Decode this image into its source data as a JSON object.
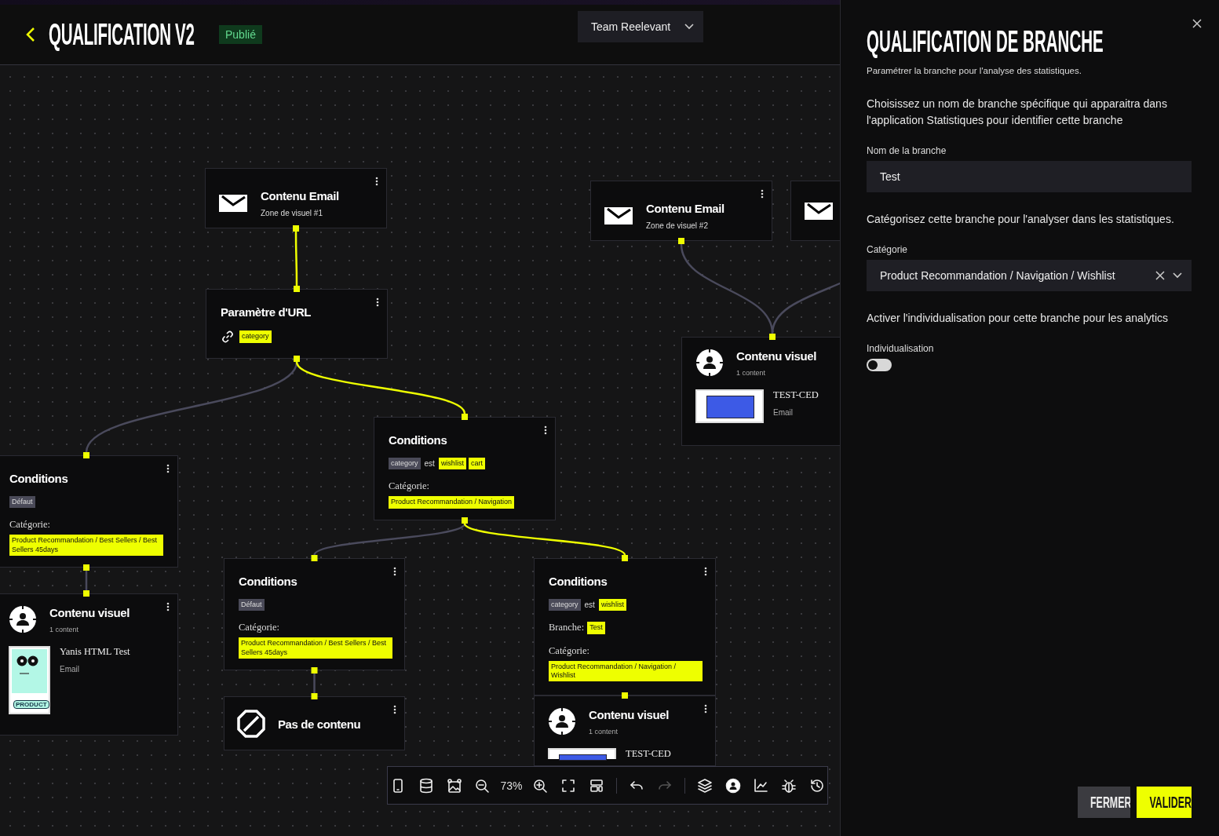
{
  "header": {
    "title": "QUALIFICATION V2",
    "status": "Publié",
    "team": "Team Reelevant"
  },
  "nodes": [
    {
      "kind": "email",
      "title": "Contenu Email",
      "subtitle": "Zone de visuel #1"
    },
    {
      "kind": "email",
      "title": "Contenu Email",
      "subtitle": "Zone de visuel #2"
    },
    {
      "kind": "email"
    },
    {
      "kind": "url_param",
      "title": "Paramètre d'URL",
      "param": "category"
    },
    {
      "kind": "visual",
      "title": "Contenu visuel",
      "count": "1 content",
      "item": {
        "name": "TEST-CED",
        "type": "Email",
        "kind": "banner"
      }
    },
    {
      "kind": "conditions",
      "title": "Conditions",
      "rule": {
        "field": "category",
        "operator": "est",
        "values": [
          "wishlist",
          "cart"
        ]
      },
      "category_label": "Catégorie:",
      "category": "Product Recommandation / Navigation"
    },
    {
      "kind": "conditions",
      "title": "Conditions",
      "default": "Défaut",
      "category_label": "Catégorie:",
      "category": "Product Recommandation / Best Sellers / Best Sellers 45days"
    },
    {
      "kind": "visual",
      "title": "Contenu visuel",
      "count": "1 content",
      "item": {
        "name": "Yanis HTML Test",
        "type": "Email",
        "kind": "product",
        "tag": "PRODUCT"
      }
    },
    {
      "kind": "conditions",
      "title": "Conditions",
      "default": "Défaut",
      "category_label": "Catégorie:",
      "category": "Product Recommandation / Best Sellers / Best Sellers 45days"
    },
    {
      "kind": "empty",
      "title": "Pas de contenu"
    },
    {
      "kind": "conditions",
      "title": "Conditions",
      "rule": {
        "field": "category",
        "operator": "est",
        "values": [
          "wishlist"
        ]
      },
      "branch_label": "Branche:",
      "branch": "Test",
      "category_label": "Catégorie:",
      "category": "Product Recommandation / Navigation / Wishlist"
    },
    {
      "kind": "visual",
      "title": "Contenu visuel",
      "count": "1 content",
      "item": {
        "name": "TEST-CED",
        "kind": "banner"
      }
    }
  ],
  "connections": [
    {
      "active": true
    },
    {
      "active": false
    },
    {
      "active": true
    },
    {
      "active": false
    },
    {
      "active": false
    },
    {
      "active": false
    },
    {
      "active": false
    },
    {
      "active": true
    },
    {
      "active": false
    }
  ],
  "toolbar": {
    "zoom": "73%",
    "buttons": [
      {
        "kind": "mobile",
        "disabled": false
      },
      {
        "kind": "database",
        "disabled": false
      },
      {
        "kind": "image",
        "disabled": false
      },
      {
        "kind": "zoom_out",
        "disabled": false
      },
      {
        "kind": "zoom_label"
      },
      {
        "kind": "zoom_in",
        "disabled": false
      },
      {
        "kind": "fullscreen",
        "disabled": false
      },
      {
        "kind": "layout",
        "disabled": false
      },
      {
        "kind": "separator"
      },
      {
        "kind": "undo",
        "disabled": false
      },
      {
        "kind": "redo",
        "disabled": true
      },
      {
        "kind": "separator"
      },
      {
        "kind": "layers",
        "disabled": false
      },
      {
        "kind": "avatar",
        "disabled": false
      },
      {
        "kind": "chart",
        "disabled": false
      },
      {
        "kind": "bug",
        "disabled": false
      },
      {
        "kind": "history",
        "disabled": false
      }
    ]
  },
  "panel": {
    "title": "QUALIFICATION DE BRANCHE",
    "subtitle": "Paramétrer la branche pour l'analyse des statistiques.",
    "name_help": "Choisissez un nom de branche spécifique qui apparaitra dans l'application Statistiques pour identifier cette branche",
    "name_label": "Nom de la branche",
    "name_value": "Test",
    "category_help": "Catégorisez cette branche pour l'analyser dans les statistiques.",
    "category_label": "Catégorie",
    "category_value": "Product Recommandation / Navigation / Wishlist",
    "individual_help": "Activer l'individualisation pour cette branche pour les analytics",
    "individual_label": "Individualisation",
    "individual_on": false,
    "buttons": [
      {
        "label": "FERMER",
        "kind": "secondary"
      },
      {
        "label": "VALIDER",
        "kind": "primary"
      }
    ]
  }
}
